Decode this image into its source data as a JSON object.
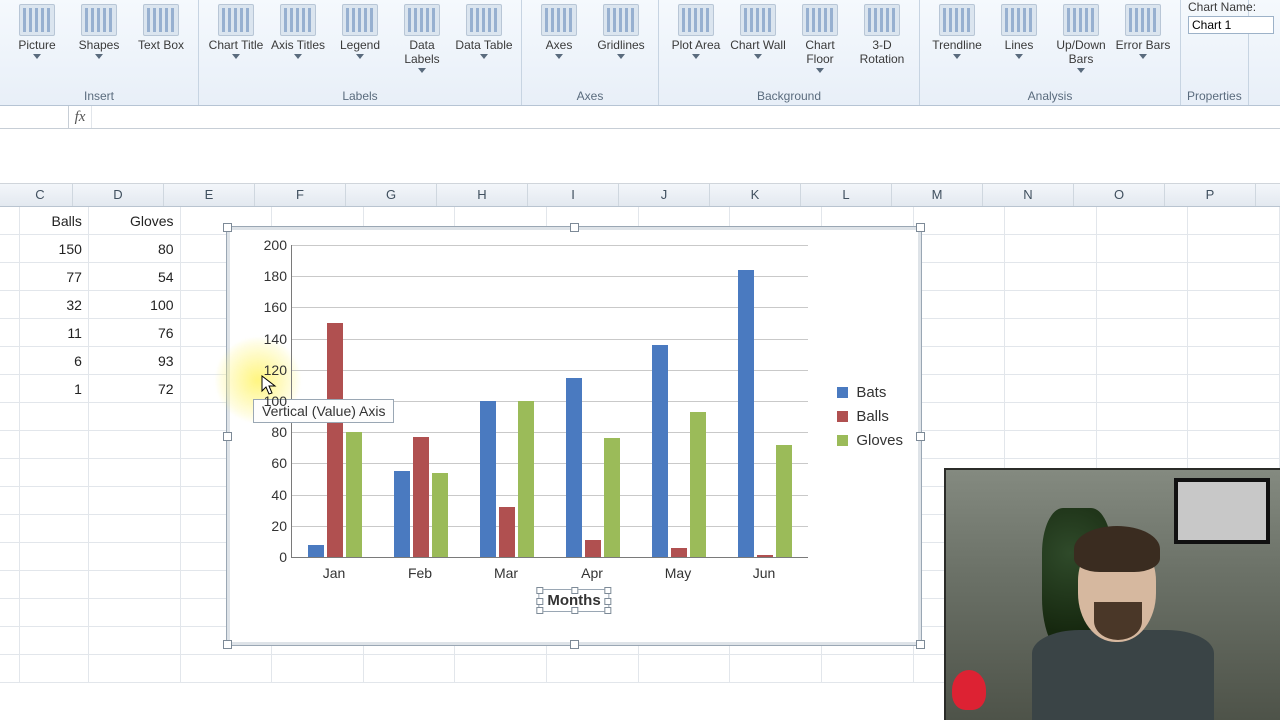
{
  "ribbon": {
    "groups": [
      {
        "label": "Insert",
        "buttons": [
          {
            "label": "Picture",
            "name": "picture-button",
            "drop": true
          },
          {
            "label": "Shapes",
            "name": "shapes-button",
            "drop": true
          },
          {
            "label": "Text Box",
            "name": "text-box-button",
            "drop": false
          }
        ]
      },
      {
        "label": "Labels",
        "buttons": [
          {
            "label": "Chart Title",
            "name": "chart-title-button",
            "drop": true
          },
          {
            "label": "Axis Titles",
            "name": "axis-titles-button",
            "drop": true
          },
          {
            "label": "Legend",
            "name": "legend-button",
            "drop": true
          },
          {
            "label": "Data Labels",
            "name": "data-labels-button",
            "drop": true
          },
          {
            "label": "Data Table",
            "name": "data-table-button",
            "drop": true
          }
        ]
      },
      {
        "label": "Axes",
        "buttons": [
          {
            "label": "Axes",
            "name": "axes-button",
            "drop": true
          },
          {
            "label": "Gridlines",
            "name": "gridlines-button",
            "drop": true
          }
        ]
      },
      {
        "label": "Background",
        "buttons": [
          {
            "label": "Plot Area",
            "name": "plot-area-button",
            "drop": true
          },
          {
            "label": "Chart Wall",
            "name": "chart-wall-button",
            "drop": true
          },
          {
            "label": "Chart Floor",
            "name": "chart-floor-button",
            "drop": true
          },
          {
            "label": "3-D Rotation",
            "name": "rotation-3d-button",
            "drop": false
          }
        ]
      },
      {
        "label": "Analysis",
        "buttons": [
          {
            "label": "Trendline",
            "name": "trendline-button",
            "drop": true
          },
          {
            "label": "Lines",
            "name": "lines-button",
            "drop": true
          },
          {
            "label": "Up/Down Bars",
            "name": "up-down-bars-button",
            "drop": true
          },
          {
            "label": "Error Bars",
            "name": "error-bars-button",
            "drop": true
          }
        ]
      },
      {
        "label": "Properties",
        "buttons": []
      }
    ],
    "properties": {
      "label": "Chart Name:",
      "value": "Chart 1"
    }
  },
  "formula_bar": {
    "fx": "fx",
    "name_box": "",
    "formula": ""
  },
  "columns": [
    "C",
    "D",
    "E",
    "F",
    "G",
    "H",
    "I",
    "J",
    "K",
    "L",
    "M",
    "N",
    "O",
    "P"
  ],
  "table": {
    "headers": [
      "Balls",
      "Gloves"
    ],
    "rows": [
      [
        150,
        80
      ],
      [
        77,
        54
      ],
      [
        32,
        100
      ],
      [
        11,
        76
      ],
      [
        6,
        93
      ],
      [
        1,
        72
      ]
    ]
  },
  "tooltip": "Vertical (Value) Axis",
  "chart_data": {
    "type": "bar",
    "categories": [
      "Jan",
      "Feb",
      "Mar",
      "Apr",
      "May",
      "Jun"
    ],
    "series": [
      {
        "name": "Bats",
        "values": [
          8,
          55,
          100,
          115,
          136,
          184
        ],
        "color": "#4a7ac0"
      },
      {
        "name": "Balls",
        "values": [
          150,
          77,
          32,
          11,
          6,
          1
        ],
        "color": "#b05050"
      },
      {
        "name": "Gloves",
        "values": [
          80,
          54,
          100,
          76,
          93,
          72
        ],
        "color": "#9bbb59"
      }
    ],
    "ylim": [
      0,
      200
    ],
    "yticks": [
      0,
      20,
      40,
      60,
      80,
      100,
      120,
      140,
      160,
      180,
      200
    ],
    "xlabel": "Months",
    "legend_position": "right"
  },
  "chart_name": "Chart 1"
}
